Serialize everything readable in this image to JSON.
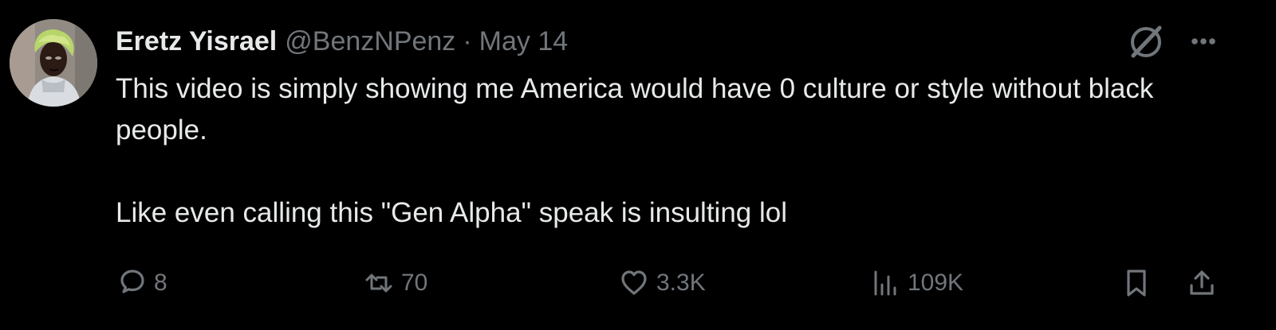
{
  "tweet": {
    "author": {
      "display_name": "Eretz Yisrael",
      "handle": "@BenzNPenz"
    },
    "separator": "·",
    "date": "May 14",
    "paragraphs": [
      "This video is simply showing me America would have 0 culture or style without black people.",
      "Like even calling this \"Gen Alpha\" speak is insulting lol"
    ],
    "header_icons": [
      "grok-icon",
      "more-icon"
    ],
    "actions": {
      "reply": {
        "icon": "reply-icon",
        "count": "8"
      },
      "retweet": {
        "icon": "retweet-icon",
        "count": "70"
      },
      "like": {
        "icon": "heart-icon",
        "count": "3.3K"
      },
      "views": {
        "icon": "views-icon",
        "count": "109K"
      },
      "bookmark": {
        "icon": "bookmark-icon"
      },
      "share": {
        "icon": "share-icon"
      }
    }
  },
  "colors": {
    "background": "#000000",
    "primary_text": "#e7e9ea",
    "secondary_text": "#71767b"
  }
}
